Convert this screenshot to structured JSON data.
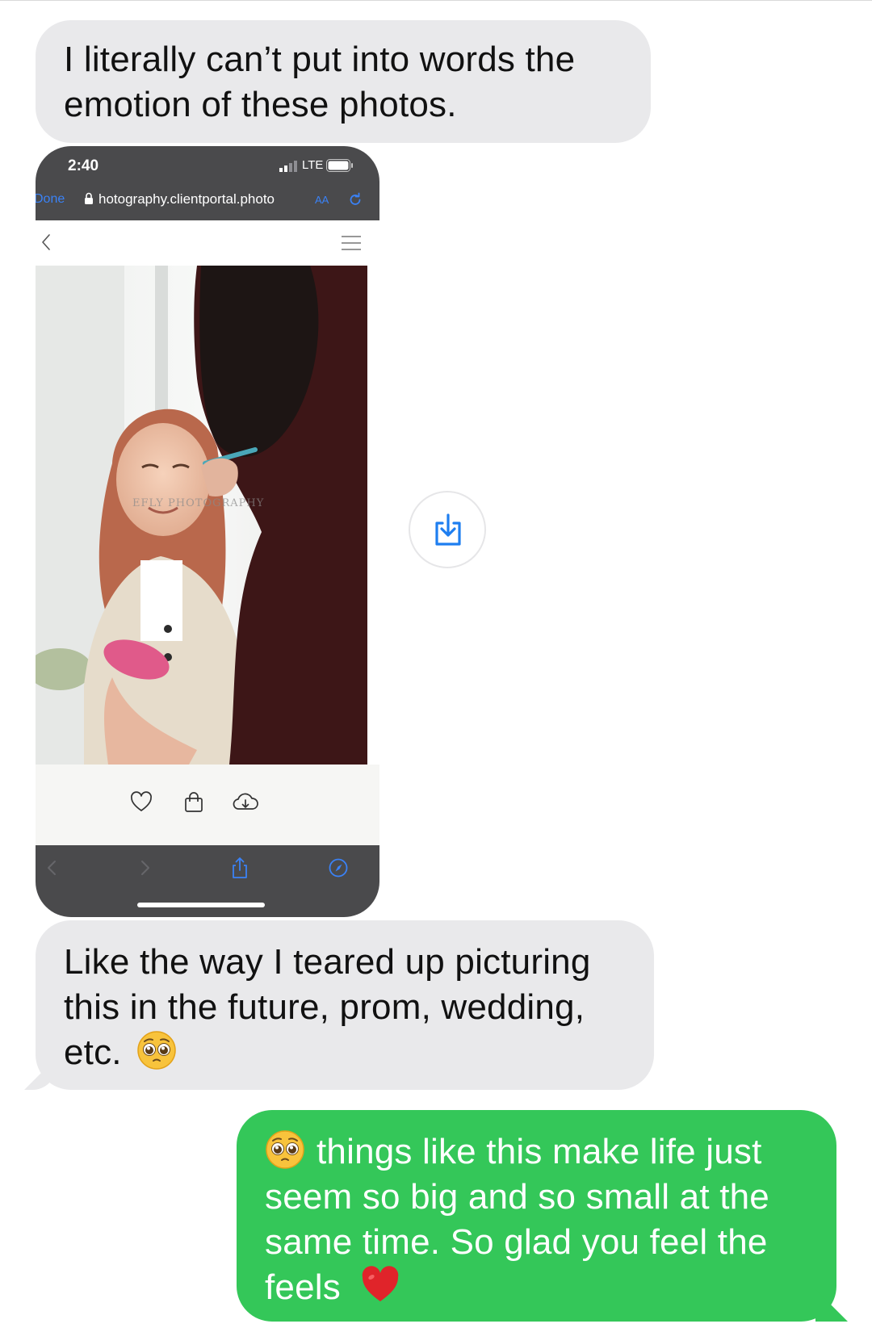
{
  "messages": {
    "first": {
      "lines": [
        "I literally can’t put into words the",
        "emotion of these photos."
      ]
    },
    "second": {
      "lines": [
        "Like the way I teared up picturing",
        "this in the future, prom, wedding,",
        "etc."
      ],
      "emoji": "pleading-face"
    },
    "reply": {
      "lines": [
        "things like this make life just",
        "seem so big and so small at the",
        "same time. So glad you feel the",
        "feels"
      ],
      "emoji_start": "pleading-face",
      "emoji_end": "red-heart"
    }
  },
  "screenshot": {
    "status_bar": {
      "time": "2:40",
      "network": "LTE"
    },
    "browser_bar": {
      "done_label": "Done",
      "url": "hotography.clientportal.photo",
      "aa_label": "AA"
    },
    "photo": {
      "watermark": "EFLY PHOTOGRAPHY"
    },
    "toolbar_icons": [
      "heart-icon",
      "bag-icon",
      "cloud-download-icon"
    ],
    "bottom_icons": [
      "back-chevron-icon",
      "forward-chevron-icon",
      "share-icon",
      "compass-icon"
    ]
  },
  "save_button": {
    "icon": "save-download-icon"
  },
  "colors": {
    "incoming_bubble": "#e9e9eb",
    "outgoing_bubble": "#34c759",
    "link_blue": "#3a82f6",
    "phone_dark": "#4a4a4c"
  }
}
